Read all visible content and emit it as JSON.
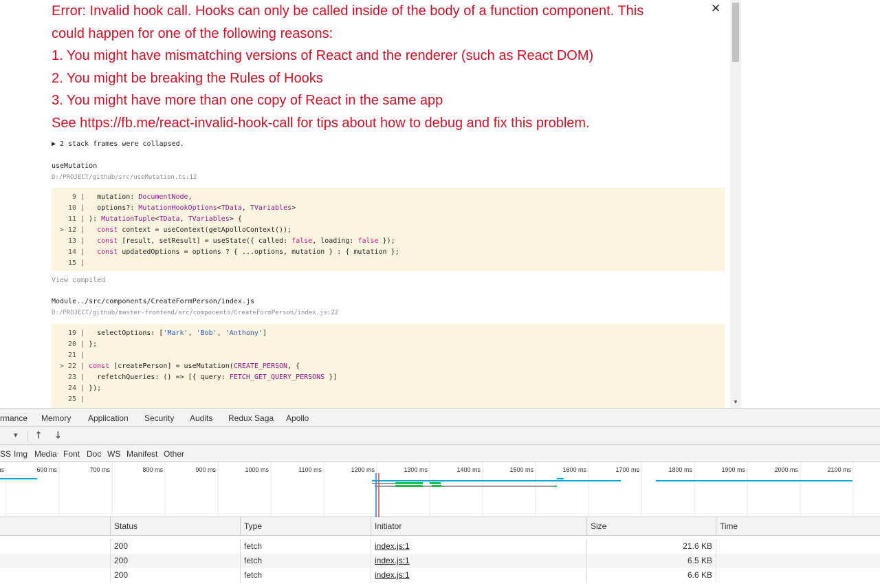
{
  "overlay": {
    "close_label": "×",
    "error_lines": [
      "Error: Invalid hook call. Hooks can only be called inside of the body of a function component. This",
      "could happen for one of the following reasons:",
      "1. You might have mismatching versions of React and the renderer (such as React DOM)",
      "2. You might be breaking the Rules of Hooks",
      "3. You might have more than one copy of React in the same app",
      "See https://fb.me/react-invalid-hook-call for tips about how to debug and fix this problem."
    ],
    "collapsed_text": "▶ 2 stack frames were collapsed.",
    "frames": [
      {
        "name": "useMutation",
        "path": "D:/PROJECT/github/src/useMutation.ts:12",
        "lines": [
          {
            "marker": " ",
            "num": "9",
            "code": "  mutation: DocumentNode,"
          },
          {
            "marker": " ",
            "num": "10",
            "code": "  options?: MutationHookOptions<TData, TVariables>"
          },
          {
            "marker": " ",
            "num": "11",
            "code": "): MutationTuple<TData, TVariables> {"
          },
          {
            "marker": ">",
            "num": "12",
            "code": "  const context = useContext(getApolloContext());"
          },
          {
            "marker": " ",
            "num": "13",
            "code": "  const [result, setResult] = useState({ called: false, loading: false });"
          },
          {
            "marker": " ",
            "num": "14",
            "code": "  const updatedOptions = options ? { ...options, mutation } : { mutation };"
          },
          {
            "marker": " ",
            "num": "15",
            "code": ""
          }
        ]
      },
      {
        "name": "Module../src/components/CreateFormPerson/index.js",
        "path": "D:/PROJECT/github/master-frontend/src/components/CreateFormPerson/index.js:22",
        "lines": [
          {
            "marker": " ",
            "num": "19",
            "code": "  selectOptions: ['Mark', 'Bob', 'Anthony']"
          },
          {
            "marker": " ",
            "num": "20",
            "code": "};"
          },
          {
            "marker": " ",
            "num": "21",
            "code": ""
          },
          {
            "marker": ">",
            "num": "22",
            "code": "const [createPerson] = useMutation(CREATE_PERSON, {"
          },
          {
            "marker": " ",
            "num": "23",
            "code": "  refetchQueries: () => [{ query: FETCH_GET_QUERY_PERSONS }]"
          },
          {
            "marker": " ",
            "num": "24",
            "code": "});"
          },
          {
            "marker": " ",
            "num": "25",
            "code": ""
          }
        ]
      }
    ],
    "view_compiled": "View compiled"
  },
  "devtools": {
    "tabs": [
      "rmance",
      "Memory",
      "Application",
      "Security",
      "Audits",
      "Redux Saga",
      "Apollo"
    ],
    "toolbar": {
      "dropdown": "▾",
      "import": "⭡",
      "export": "⭣"
    },
    "filters": [
      "SS",
      "Img",
      "Media",
      "Font",
      "Doc",
      "WS",
      "Manifest",
      "Other"
    ],
    "timeline_ticks": [
      "ms",
      "600 ms",
      "700 ms",
      "800 ms",
      "900 ms",
      "1000 ms",
      "1100 ms",
      "1200 ms",
      "1300 ms",
      "1400 ms",
      "1500 ms",
      "1600 ms",
      "1700 ms",
      "1800 ms",
      "1900 ms",
      "2000 ms",
      "2100 ms"
    ],
    "columns": [
      "Status",
      "Type",
      "Initiator",
      "Size",
      "Time"
    ],
    "rows": [
      {
        "status": "200",
        "type": "fetch",
        "initiator": "index.js:1",
        "size": "21.6 KB",
        "time": ""
      },
      {
        "status": "200",
        "type": "fetch",
        "initiator": "index.js:1",
        "size": "6.5 KB",
        "time": ""
      },
      {
        "status": "200",
        "type": "fetch",
        "initiator": "index.js:1",
        "size": "6.6 KB",
        "time": ""
      }
    ],
    "colors": {
      "waiting": "#00a6da",
      "receiving": "#1ec04c",
      "stalled": "#9a9a9a",
      "dcl": "#3879d9",
      "load": "#e5403a"
    }
  }
}
